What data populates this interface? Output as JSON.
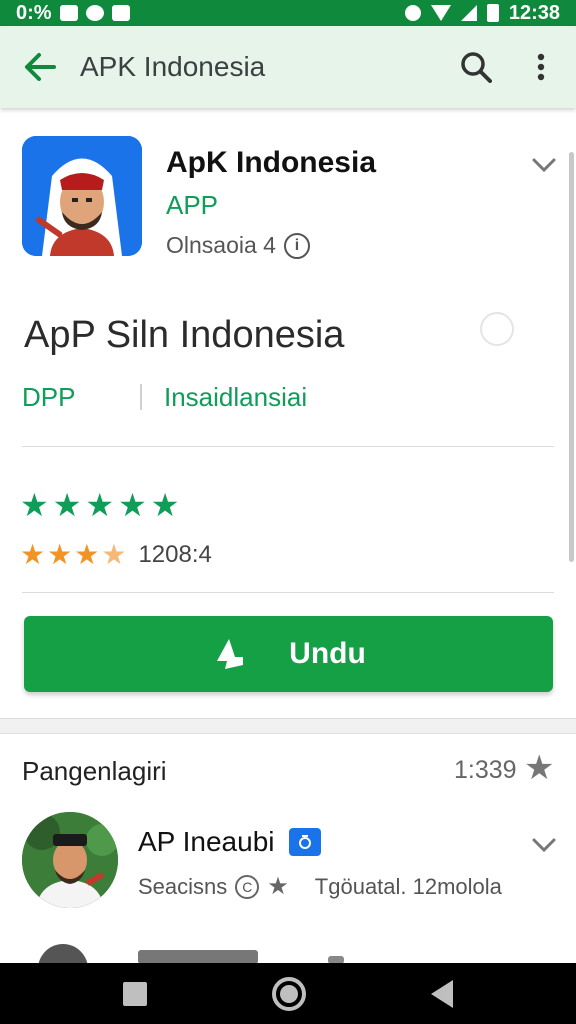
{
  "status_bar": {
    "left_text": "0:%",
    "time": "12:38"
  },
  "toolbar": {
    "title": "APK Indonesia"
  },
  "app": {
    "name": "ApK  Indonesia",
    "type": "APP",
    "meta": "Olnsaoia  4",
    "info_glyph": "i",
    "headline": "ApP Siln Indonesia",
    "category": "DPP",
    "install_status": "Insaidlansiai",
    "rating_count": "1208:4",
    "green_stars": 5,
    "orange_stars": 3.5
  },
  "install_button": {
    "label": "Undu"
  },
  "section": {
    "title": "Pangenlagiri",
    "count": "1:339"
  },
  "list_item": {
    "title": "AP Ineaubi",
    "sub_left": "Seacisns",
    "sub_circle": "C",
    "sub_right": "Tgöuatal. 12molola"
  },
  "colors": {
    "accent_green": "#0f9d58",
    "button_green": "#15a046",
    "status_bar": "#0f8a3c",
    "toolbar_bg": "#e6f4ea",
    "star_orange": "#f29425"
  },
  "icons": {
    "back": "arrow-left-icon",
    "search": "search-icon",
    "more": "more-vert-icon",
    "chevron": "chevron-down-icon",
    "download": "download-icon",
    "star": "star-icon",
    "verified": "verified-badge-icon"
  }
}
